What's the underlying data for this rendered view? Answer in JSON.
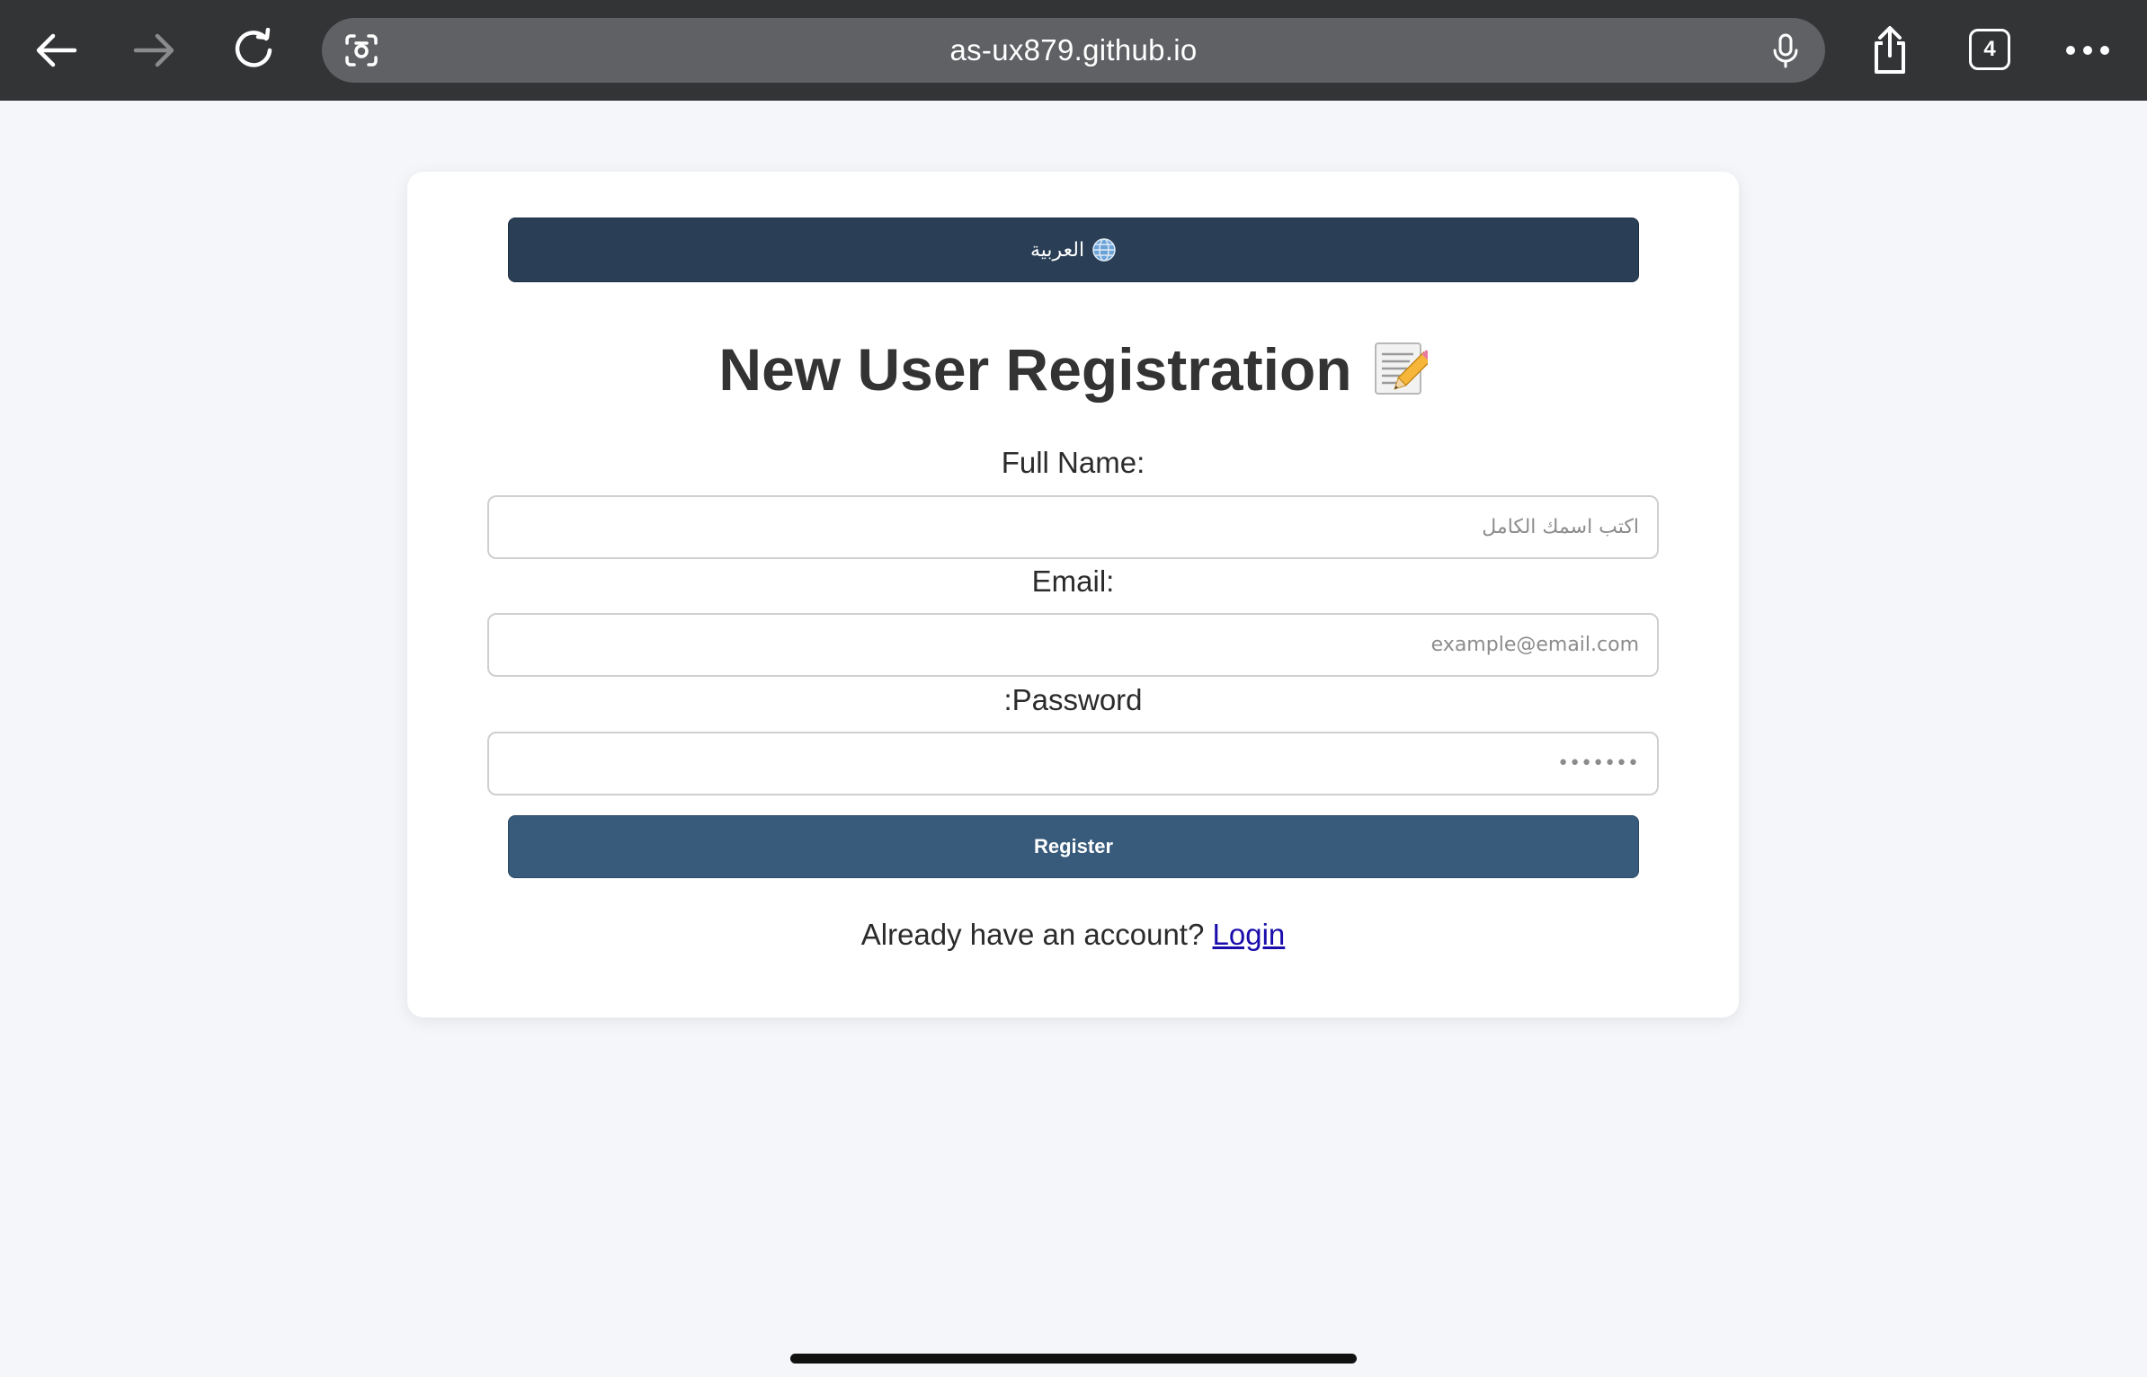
{
  "browser": {
    "url": "as-ux879.github.io",
    "tab_count": "4",
    "icons": {
      "back": "back-arrow-icon",
      "forward": "forward-arrow-icon",
      "reload": "reload-icon",
      "lens": "camera-search-icon",
      "mic": "microphone-icon",
      "share": "share-icon",
      "more": "more-dots-icon"
    },
    "colors": {
      "toolbar": "#333436",
      "address_bar": "#5f6164"
    }
  },
  "page": {
    "language_button": "العربية",
    "title": "New User Registration",
    "fields": {
      "full_name": {
        "label": "Full Name:",
        "placeholder": "اكتب اسمك الكامل"
      },
      "email": {
        "label": "Email:",
        "placeholder": "example@email.com"
      },
      "password": {
        "label": ":Password",
        "placeholder": "•••••••"
      }
    },
    "register_button": "Register",
    "login_prompt": "Already have an account?",
    "login_link": "Login",
    "colors": {
      "language_button": "#2a3f56",
      "register_button": "#385b7b",
      "link": "#1a0dab",
      "background": "#f4f6f9"
    }
  }
}
